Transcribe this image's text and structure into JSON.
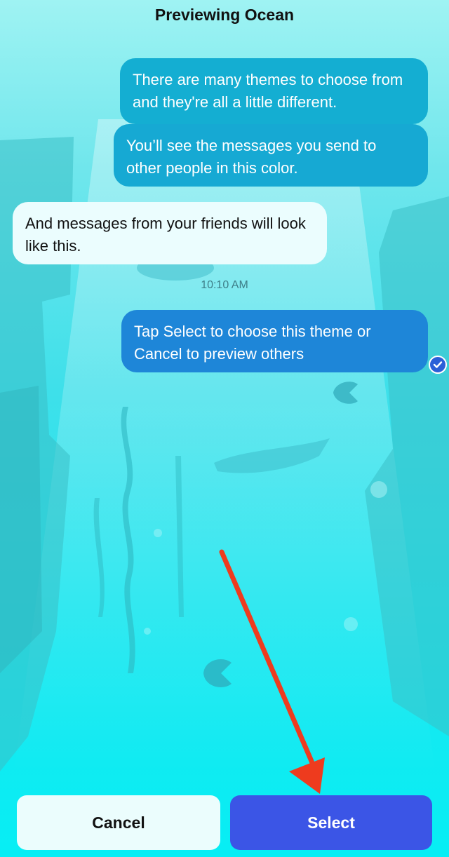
{
  "header": {
    "title": "Previewing Ocean"
  },
  "messages": {
    "sent_1": "There are many themes to choose from and they're all a little different.",
    "sent_2": "You’ll see the messages you send to other people in this color.",
    "received_1": "And messages from your friends will look like this.",
    "timestamp": "10:10 AM",
    "sent_3": "Tap Select to choose this theme or Cancel to preview others"
  },
  "actions": {
    "cancel_label": "Cancel",
    "select_label": "Select"
  },
  "colors": {
    "sent_bubble_top": "#14aed2",
    "sent_bubble_bottom": "#1e86d8",
    "received_bubble": "#ebfdfe",
    "select_button": "#3b55e6",
    "cancel_button": "#ebfdfd",
    "annotation_arrow": "#ee3b1e"
  },
  "icons": {
    "read_receipt": "checkmark-circle-icon",
    "annotation": "red-arrow-icon"
  }
}
